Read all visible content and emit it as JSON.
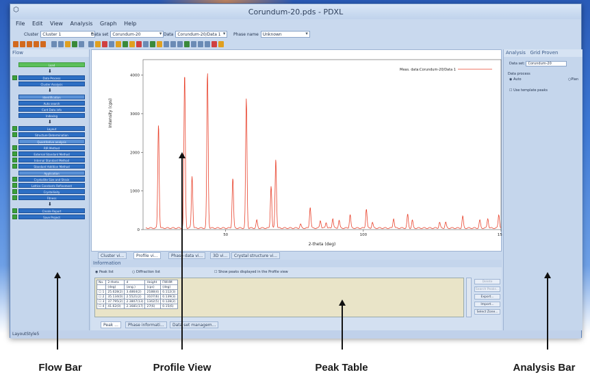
{
  "window": {
    "title": "Corundum-20.pds - PDXL"
  },
  "menu": [
    "File",
    "Edit",
    "View",
    "Analysis",
    "Graph",
    "Help"
  ],
  "selectors": {
    "cluster": {
      "label": "Cluster",
      "value": "Cluster 1"
    },
    "dataset": {
      "label": "Data set",
      "value": "Corundum-20"
    },
    "data": {
      "label": "Data",
      "value": "Corundum-20/Data 1"
    },
    "phase": {
      "label": "Phase name",
      "value": "Unknown"
    }
  },
  "flow": {
    "title": "Flow",
    "items": [
      "Load",
      "Data Process",
      "Cluster Analysis",
      "Identification",
      "Auto search",
      "Card Data info",
      "Indexing",
      "Layout",
      "Structure Determination",
      "Quantitative analysis",
      "RIR Method",
      "External Standard Method",
      "Internal Standard Method",
      "Standard Addition Method",
      "Application",
      "Crystallite Size and Strain",
      "Lattice Constants Refinement",
      "Crystallinity",
      "Fitness",
      "Create Report",
      "Save Project"
    ]
  },
  "plot": {
    "legend": "Meas. data:Corundum-20/Data 1",
    "ylabel": "Intensity (cps)",
    "xlabel": "2-theta (deg)",
    "color_line": "#e8402a"
  },
  "chart_data": {
    "type": "line",
    "title": "",
    "xlabel": "2-theta (deg)",
    "ylabel": "Intensity (cps)",
    "xlim": [
      20,
      150
    ],
    "ylim": [
      0,
      4400
    ],
    "xticks": [
      50,
      100,
      150
    ],
    "yticks": [
      0,
      1000,
      2000,
      3000,
      4000
    ],
    "series": [
      {
        "name": "Meas. data:Corundum-20/Data 1",
        "peaks_x": [
          25.6,
          35.1,
          37.8,
          43.4,
          52.6,
          57.5,
          61.3,
          66.5,
          68.2,
          77.2,
          80.7,
          84.4,
          86.5,
          88.9,
          91.2,
          95.2,
          101.1,
          103.3,
          111.0,
          116.1,
          117.8,
          127.7,
          129.9,
          136.1,
          142.3,
          145.2,
          149.2
        ],
        "peaks_y": [
          2700,
          4000,
          1350,
          4050,
          1300,
          3350,
          200,
          1100,
          1800,
          100,
          550,
          200,
          150,
          250,
          200,
          350,
          500,
          150,
          250,
          350,
          200,
          150,
          150,
          300,
          200,
          250,
          350
        ]
      }
    ]
  },
  "tabs": [
    "Cluster vi...",
    "Profile vi...",
    "Phase data vi...",
    "3D vi...",
    "Crystal structure vi..."
  ],
  "info": {
    "title": "Information",
    "radio1": "Peak list",
    "radio2": "Diffraction list",
    "checkbox": "Show peaks displayed in the Profile view",
    "headers": [
      "No.",
      "2-theta",
      "d",
      "Height",
      "FWHM"
    ],
    "units": [
      "",
      "(deg)",
      "(ang.)",
      "(cps)",
      "(deg)"
    ],
    "rows": [
      [
        "1",
        "25.628(2)",
        "3.4864(2)",
        "2188(4)",
        "0.112(3)"
      ],
      [
        "2",
        "35.134(0)",
        "2.5521(2)",
        "3107(6)",
        "0.139(3)"
      ],
      [
        "3",
        "37.795(2)",
        "2.3807(13)",
        "1342(5)",
        "0.128(2)"
      ],
      [
        "4",
        "41.62(0)",
        "2.1681(17)",
        "27(6)",
        "0.15(6)"
      ]
    ],
    "buttons": [
      "Delete",
      "Search Peaks...",
      "Export...",
      "Import...",
      "Select Zone..."
    ],
    "bottom_tabs": [
      "Peak ...",
      "Phase informati...",
      "Data set managem..."
    ]
  },
  "analysis": {
    "tabs": [
      "Analysis",
      "Grid Proven"
    ],
    "dataset_label": "Data set:",
    "dataset_value": "Corundum-20",
    "group": "Data process",
    "auto": "Auto",
    "manual": "Plan",
    "template": "Use template peaks"
  },
  "status": "LayoutStyle5",
  "callouts": [
    "Flow Bar",
    "Profile View",
    "Peak Table",
    "Analysis Bar"
  ]
}
